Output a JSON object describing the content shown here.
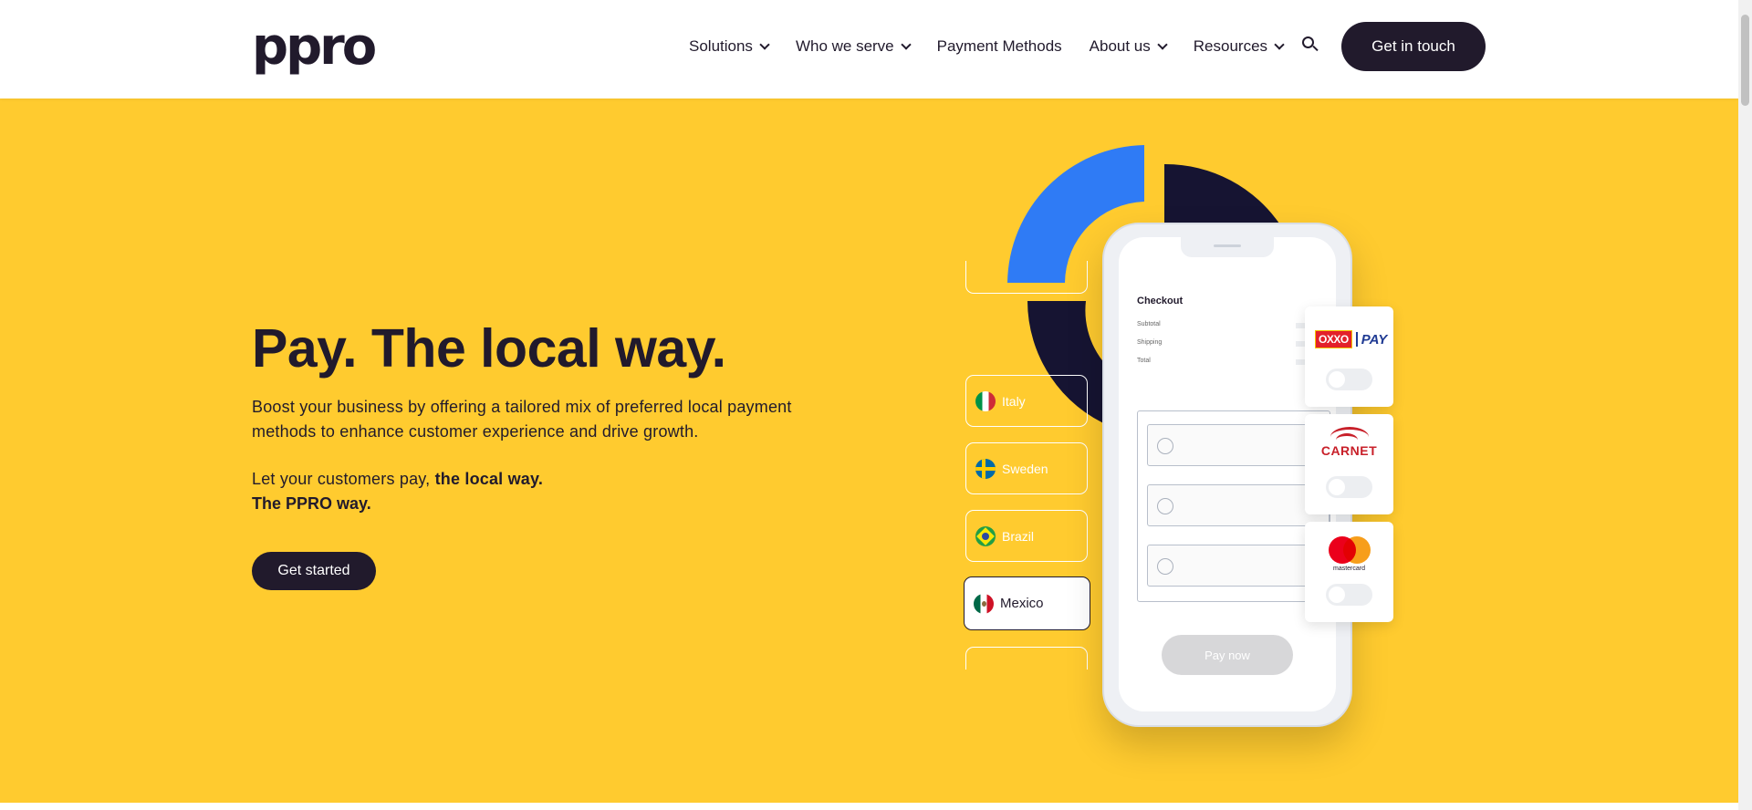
{
  "brand": {
    "logo": "ppro"
  },
  "nav": {
    "items": [
      {
        "label": "Solutions",
        "has_dropdown": true
      },
      {
        "label": "Who we serve",
        "has_dropdown": true
      },
      {
        "label": "Payment Methods",
        "has_dropdown": false
      },
      {
        "label": "About us",
        "has_dropdown": true
      },
      {
        "label": "Resources",
        "has_dropdown": true
      }
    ],
    "search_icon": "search-icon",
    "cta": "Get in touch"
  },
  "hero": {
    "title": "Pay. The local way.",
    "description": "Boost your business by offering a tailored mix of preferred local payment methods to enhance customer experience and drive growth.",
    "line2_prefix": "Let your customers pay,",
    "line2_bold": "the local way.",
    "line3": "The PPRO way.",
    "cta": "Get started"
  },
  "illustration": {
    "countries": [
      {
        "name": "Italy",
        "active": false
      },
      {
        "name": "Sweden",
        "active": false
      },
      {
        "name": "Brazil",
        "active": false
      },
      {
        "name": "Mexico",
        "active": true
      }
    ],
    "checkout": {
      "title": "Checkout",
      "rows": [
        "Subtotal",
        "Shipping",
        "Total"
      ],
      "pay_button": "Pay now"
    },
    "payment_methods": [
      {
        "name": "OXXO PAY",
        "logo_text": [
          "OXXO",
          "PAY"
        ]
      },
      {
        "name": "CARNET",
        "logo_text": "CARNET"
      },
      {
        "name": "mastercard",
        "logo_text": "mastercard"
      }
    ]
  },
  "colors": {
    "brand_dark": "#211a2c",
    "hero_yellow": "#ffcb2f",
    "accent_blue": "#2f7bf5",
    "navy": "#161432"
  }
}
